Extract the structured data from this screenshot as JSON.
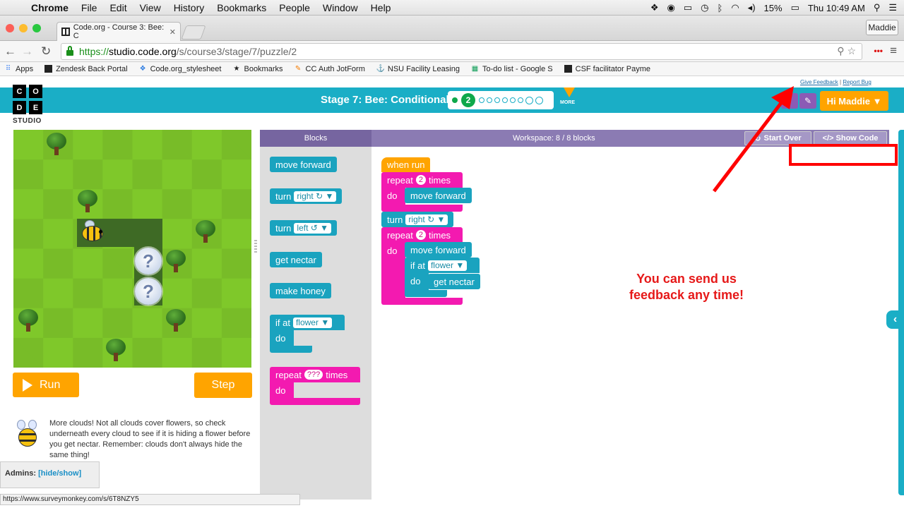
{
  "menubar": {
    "app": "Chrome",
    "items": [
      "File",
      "Edit",
      "View",
      "History",
      "Bookmarks",
      "People",
      "Window",
      "Help"
    ],
    "battery": "15%",
    "clock": "Thu 10:49 AM"
  },
  "browser": {
    "tab_title": "Code.org - Course 3: Bee: C",
    "profile": "Maddie",
    "url_scheme": "https://",
    "url_host": "studio.code.org",
    "url_path": "/s/course3/stage/7/puzzle/2",
    "bookmarks": [
      "Apps",
      "Zendesk Back Portal",
      "Code.org_stylesheet",
      "Bookmarks",
      "CC Auth JotForm",
      "NSU Facility Leasing",
      "To-do list - Google S",
      "CSF facilitator Payme"
    ],
    "status_url": "https://www.surveymonkey.com/s/6T8NZY5"
  },
  "header": {
    "logo_letters": [
      "C",
      "O",
      "D",
      "E"
    ],
    "logo_studio": "STUDIO",
    "stage_title": "Stage 7: Bee: Conditionals",
    "current_puzzle": "2",
    "more_label": "MORE",
    "user_button": "Hi Maddie ▼",
    "give_feedback": "Give Feedback",
    "link_separator": "|",
    "report_bug": "Report Bug"
  },
  "controls": {
    "run": "Run",
    "step": "Step"
  },
  "instructions": "More clouds! Not all clouds cover flowers, so check underneath every cloud to see if it is hiding a flower before you get nectar. Remember: clouds don't always hide the same thing!",
  "admins": {
    "label": "Admins:",
    "link": "[hide/show]"
  },
  "blockly": {
    "blocks_header": "Blocks",
    "workspace_header": "Workspace: 8 / 8 blocks",
    "start_over": "Start Over",
    "show_code": "</> Show Code",
    "toolbox": {
      "move_forward": "move forward",
      "turn": "turn",
      "right": "right ↻ ▼",
      "left": "left ↺ ▼",
      "get_nectar": "get nectar",
      "make_honey": "make honey",
      "if_at": "if  at",
      "flower": "flower ▼",
      "do": "do",
      "repeat": "repeat",
      "unknown": "???",
      "times": "times"
    },
    "program": {
      "when_run": "when run",
      "repeat": "repeat",
      "count1": "2",
      "count2": "2",
      "times": "times",
      "do": "do",
      "move_forward": "move forward",
      "turn": "turn",
      "right": "right ↻ ▼",
      "if_at": "if  at",
      "flower": "flower ▼",
      "get_nectar": "get nectar"
    }
  },
  "annotation": {
    "message": "You can send us feedback any time!",
    "color": "#e61919"
  },
  "colors": {
    "brand_cyan": "#1aaec6",
    "orange": "#ffa400",
    "purple": "#7665a0",
    "block_cyan": "#1aa3bf",
    "block_pink": "#f31ab0"
  }
}
